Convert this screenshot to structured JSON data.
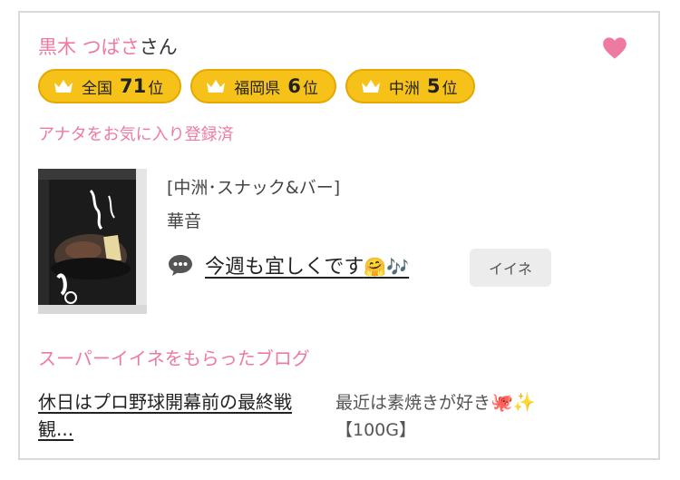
{
  "user": {
    "name_pink": "黒木 つばさ",
    "name_suffix": "さん"
  },
  "badges": [
    {
      "label": "全国",
      "rank": "71",
      "unit": "位"
    },
    {
      "label": "福岡県",
      "rank": "6",
      "unit": "位"
    },
    {
      "label": "中洲",
      "rank": "5",
      "unit": "位"
    }
  ],
  "favorite_status": "アナタをお気に入り登録済",
  "shop": {
    "genre": "[中洲･スナック&バー]",
    "name": "華音"
  },
  "post": {
    "title": "今週も宜しくです",
    "title_emoji": "🤗🎶",
    "iine_label": "イイネ"
  },
  "super_iine_heading": "スーパーイイネをもらったブログ",
  "blog": {
    "title": "休日はプロ野球開幕前の最終戦観...",
    "comment": "最近は素焼きが好き",
    "comment_emoji": "🐙✨",
    "points": "【100G】"
  },
  "colors": {
    "accent_pink": "#ee7aa1",
    "badge_gold": "#f6c21a"
  },
  "icons": [
    "heart-icon",
    "crown-icon",
    "speech-bubble-icon"
  ]
}
